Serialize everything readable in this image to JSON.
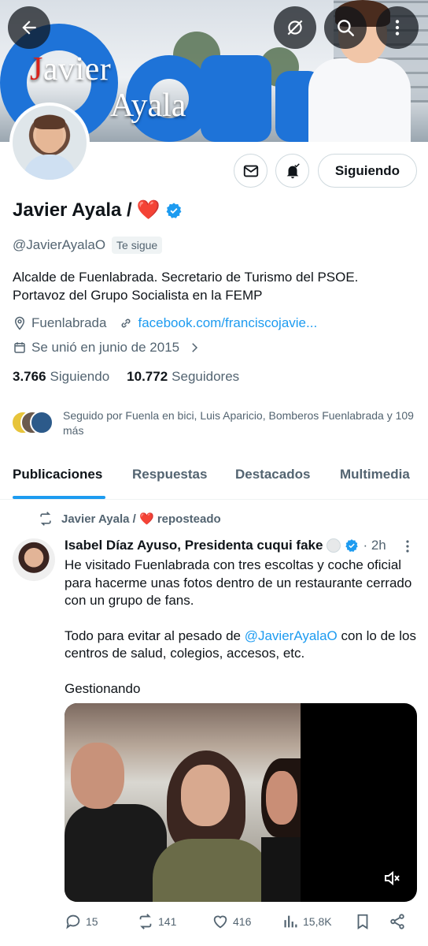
{
  "banner": {
    "line1_initial": "J",
    "line1_rest": "avier",
    "line2": "Ayala"
  },
  "toolbar": {
    "back_icon": "back-arrow-icon",
    "hide_icon": "eye-slash-icon",
    "search_icon": "search-icon",
    "more_icon": "more-vertical-icon"
  },
  "profile": {
    "display_name": "Javier Ayala /",
    "heart": "❤️",
    "handle": "@JavierAyalaO",
    "follows_you": "Te sigue",
    "bio_line1": "Alcalde de Fuenlabrada. Secretario de Turismo del PSOE.",
    "bio_line2": "Portavoz del Grupo Socialista en la FEMP",
    "location": "Fuenlabrada",
    "website": "facebook.com/franciscojavie...",
    "joined": "Se unió en junio de 2015",
    "following_count": "3.766",
    "following_label": "Siguiendo",
    "followers_count": "10.772",
    "followers_label": "Seguidores",
    "followed_by": "Seguido por Fuenla en bici, Luis Aparicio, Bomberos Fuenlabrada y 109 más"
  },
  "buttons": {
    "follow_state": "Siguiendo"
  },
  "tabs": [
    "Publicaciones",
    "Respuestas",
    "Destacados",
    "Multimedia"
  ],
  "tweet": {
    "repost_label": "Javier Ayala /",
    "repost_suffix": "reposteado",
    "author": "Isabel Díaz Ayuso, Presidenta cuqui fake",
    "time": "· 2h",
    "text1": "He visitado Fuenlabrada con tres escoltas y coche oficial para hacerme unas fotos dentro de un restaurante cerrado con un grupo de fans.",
    "text2_pre": "Todo para evitar al pesado de ",
    "text2_mention": "@JavierAyalaO",
    "text2_post": " con lo de los centros de salud, colegios, accesos, etc.",
    "text3": "Gestionando",
    "replies": "15",
    "reposts": "141",
    "likes": "416",
    "views": "15,8K"
  },
  "colors": {
    "accent": "#1d9bf0",
    "muted": "#536471",
    "heart": "#f91880"
  }
}
